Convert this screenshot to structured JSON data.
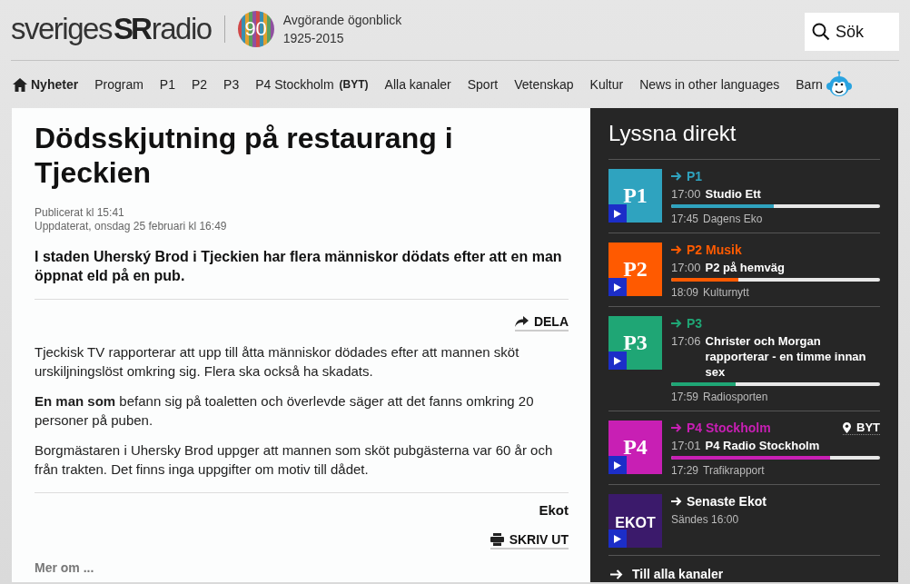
{
  "header": {
    "logo": {
      "left": "sveriges",
      "mark": "SR",
      "right": "radio"
    },
    "anniversary": {
      "badge": "90",
      "title": "Avgörande ögonblick",
      "years": "1925-2015"
    },
    "search": {
      "label": "Sök"
    }
  },
  "nav": [
    {
      "label": "Nyheter",
      "kind": "home",
      "selected": true
    },
    {
      "label": "Program",
      "kind": "link",
      "selected": false
    },
    {
      "label": "P1",
      "kind": "link",
      "selected": false
    },
    {
      "label": "P2",
      "kind": "link",
      "selected": false
    },
    {
      "label": "P3",
      "kind": "link",
      "selected": false
    },
    {
      "label": "P4 Stockholm",
      "kind": "switch",
      "badge": "(BYT)",
      "selected": false
    },
    {
      "label": "Alla kanaler",
      "kind": "link",
      "selected": false
    },
    {
      "label": "Sport",
      "kind": "link",
      "selected": false
    },
    {
      "label": "Vetenskap",
      "kind": "link",
      "selected": false
    },
    {
      "label": "Kultur",
      "kind": "link",
      "selected": false
    },
    {
      "label": "News in other languages",
      "kind": "link",
      "selected": false
    },
    {
      "label": "Barn",
      "kind": "kids",
      "selected": false
    }
  ],
  "article": {
    "title": "Dödsskjutning på restaurang i Tjeckien",
    "published": "Publicerat kl 15:41",
    "updated": "Uppdaterat, onsdag 25 februari kl 16:49",
    "lead": "I staden Uherský Brod i Tjeckien har flera människor dödats efter att en man öppnat eld på en pub.",
    "share": "DELA",
    "paragraphs": [
      "Tjeckisk TV rapporterar att upp till åtta människor dödades efter att mannen sköt urskiljningslöst omkring sig. Flera ska också ha skadats.",
      "**En man som** befann sig på toaletten och överlevde säger att det fanns omkring 20 personer på puben.",
      "Borgmästaren i Uhersky Brod uppger att mannen som sköt pubgästerna var 60 år och från trakten. Det finns inga uppgifter om motiv till dådet."
    ],
    "source": "Ekot",
    "print": "SKRIV UT",
    "more": "Mer om ..."
  },
  "live": {
    "title": "Lyssna direkt",
    "channels": [
      {
        "kind": "channel",
        "logo": "P1",
        "name": "P1",
        "color": "#2fa3bf",
        "now_time": "17:00",
        "now_title": "Studio Ett",
        "level": 0.49,
        "next_time": "17:45",
        "next_title": "Dagens Eko"
      },
      {
        "kind": "channel",
        "logo": "P2",
        "name": "P2 Musik",
        "color": "#ff5a00",
        "now_time": "17:00",
        "now_title": "P2 på hemväg",
        "level": 0.32,
        "next_time": "18:09",
        "next_title": "Kulturnytt"
      },
      {
        "kind": "channel",
        "logo": "P3",
        "name": "P3",
        "color": "#1fa675",
        "now_time": "17:06",
        "now_title": "Christer och Morgan rapporterar - en timme innan sex",
        "level": 0.31,
        "next_time": "17:59",
        "next_title": "Radiosporten"
      },
      {
        "kind": "channel",
        "logo": "P4",
        "name": "P4 Stockholm",
        "color": "#c81fb4",
        "switch": "BYT",
        "now_time": "17:01",
        "now_title": "P4 Radio Stockholm",
        "level": 0.76,
        "next_time": "17:29",
        "next_title": "Trafikrapport"
      },
      {
        "kind": "news",
        "logo": "EKOT",
        "name": "Senaste Ekot",
        "color": "#3b1a6b",
        "subtitle": "Sändes 16:00"
      }
    ],
    "all": "Till alla kanaler"
  }
}
